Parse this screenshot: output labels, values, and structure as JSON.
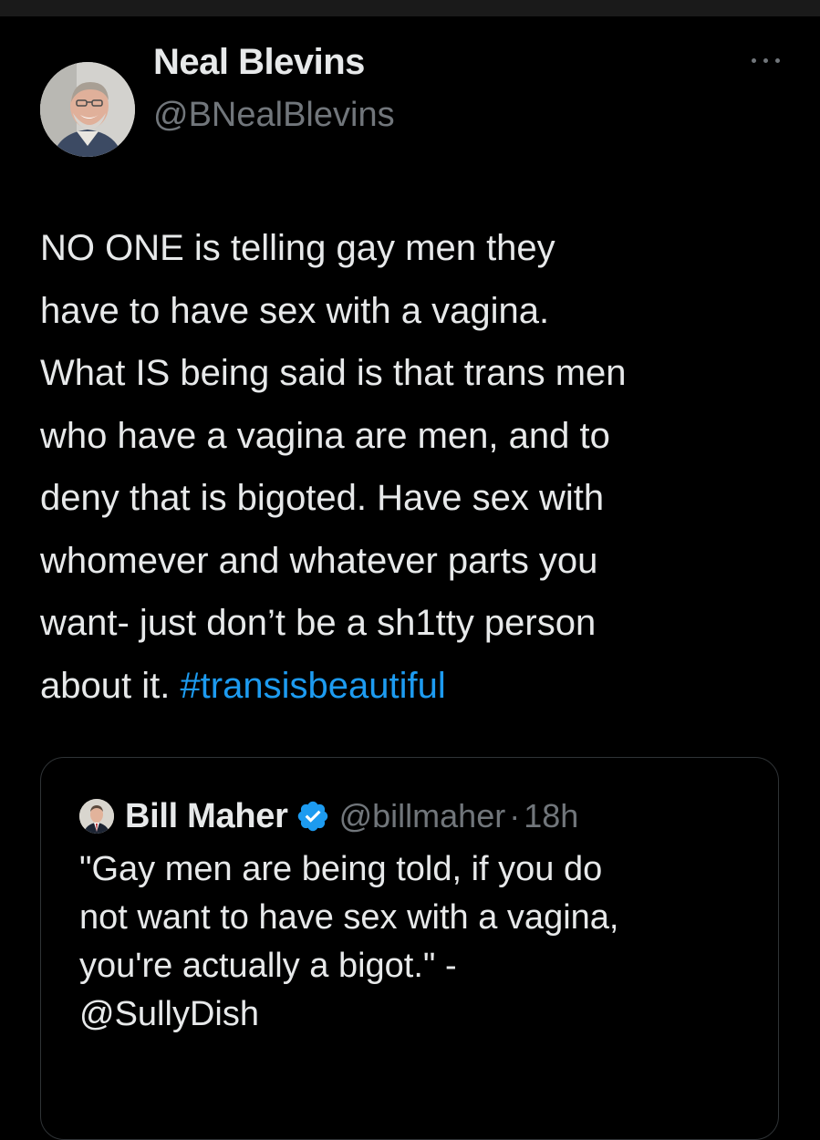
{
  "author": {
    "name": "Neal Blevins",
    "handle": "@BNealBlevins"
  },
  "more_menu_icon": "more-horizontal-icon",
  "tweet": {
    "text": "NO ONE is telling gay men they\nhave to have sex with a vagina.\nWhat IS being said is that trans men\nwho have a vagina are men, and to\ndeny that is bigoted. Have sex with\nwhomever and whatever parts you\nwant- just don’t be a sh1tty person\nabout it. ",
    "hashtag": "#transisbeautiful"
  },
  "quoted_tweet": {
    "name": "Bill Maher",
    "verified_icon": "verified-badge-icon",
    "handle": "@billmaher",
    "separator": "·",
    "time": "18h",
    "text": "\"Gay men are being told, if you do\nnot want to have sex with a vagina,\nyou're actually a bigot.\" -\n@SullyDish"
  },
  "colors": {
    "background": "#000000",
    "text": "#e7e9ea",
    "muted": "#71767b",
    "link": "#1d9bf0",
    "border": "#2f3336"
  }
}
